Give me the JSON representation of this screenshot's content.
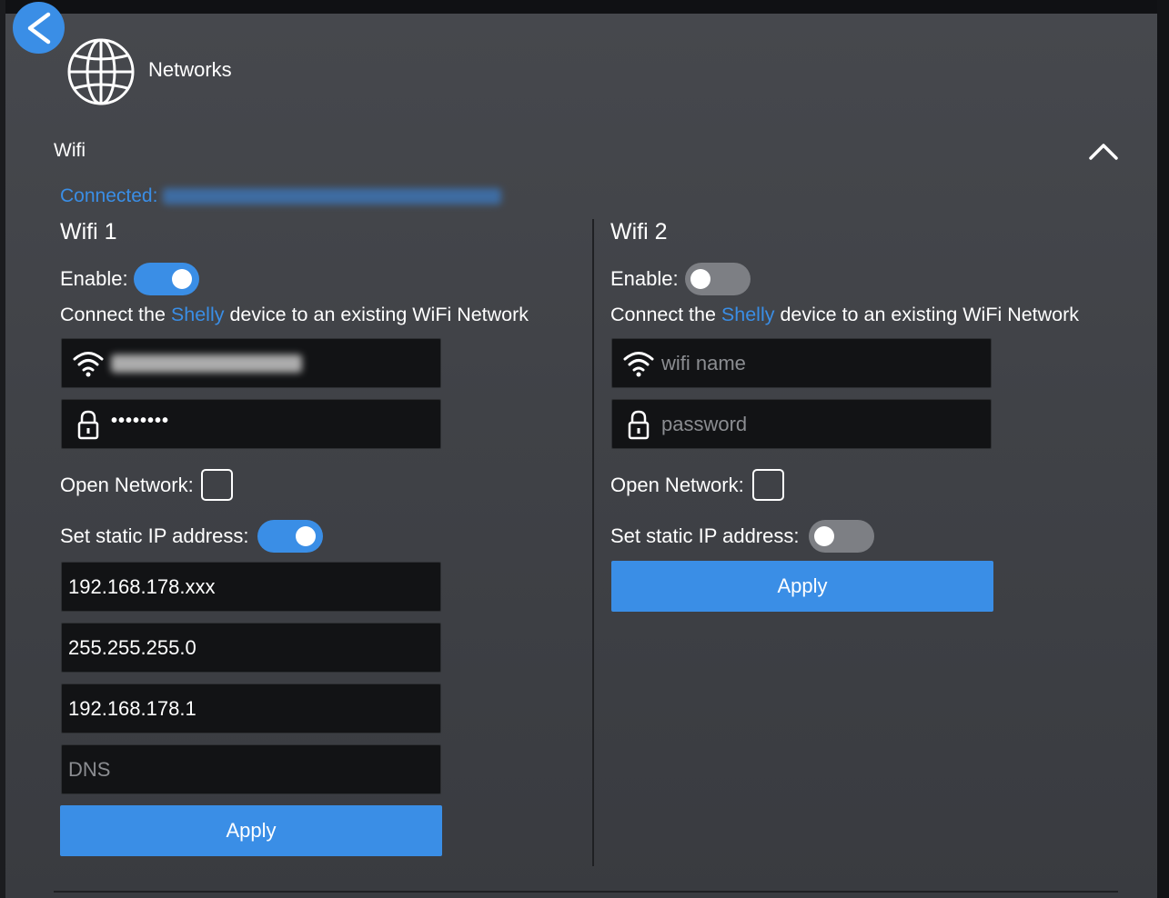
{
  "header": {
    "title": "Networks"
  },
  "section": {
    "title": "Wifi",
    "connected_label": "Connected:"
  },
  "wifi1": {
    "title": "Wifi 1",
    "enable_label": "Enable:",
    "enabled": true,
    "desc_prefix": "Connect the ",
    "desc_brand": "Shelly",
    "desc_suffix": " device to an existing WiFi Network",
    "password_masked": "••••••••",
    "open_network_label": "Open Network:",
    "open_network_checked": false,
    "static_ip_label": "Set static IP address:",
    "static_ip_enabled": true,
    "ip": "192.168.178.xxx",
    "netmask": "255.255.255.0",
    "gateway": "192.168.178.1",
    "dns_placeholder": "DNS",
    "apply_label": "Apply"
  },
  "wifi2": {
    "title": "Wifi 2",
    "enable_label": "Enable:",
    "enabled": false,
    "desc_prefix": "Connect the ",
    "desc_brand": "Shelly",
    "desc_suffix": " device to an existing WiFi Network",
    "ssid_placeholder": "wifi name",
    "password_placeholder": "password",
    "open_network_label": "Open Network:",
    "open_network_checked": false,
    "static_ip_label": "Set static IP address:",
    "static_ip_enabled": false,
    "apply_label": "Apply"
  },
  "colors": {
    "accent": "#3a8ee6",
    "panel": "#404247",
    "field": "#121315"
  }
}
